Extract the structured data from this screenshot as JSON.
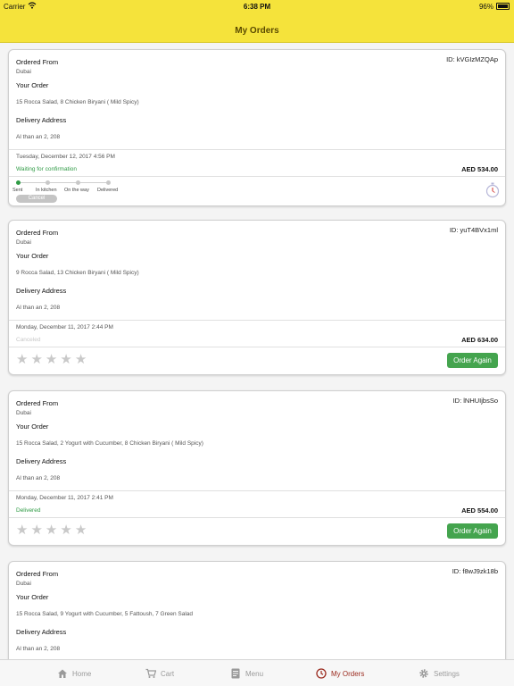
{
  "status_bar": {
    "carrier": "Carrier",
    "time": "6:38 PM",
    "battery": "96%"
  },
  "header": {
    "title": "My Orders"
  },
  "labels": {
    "ordered_from": "Ordered From",
    "your_order": "Your Order",
    "delivery_address": "Delivery Address",
    "order_again": "Order Again",
    "cancel": "Cancel"
  },
  "progress_steps": [
    "Sent",
    "In kitchen",
    "On the way",
    "Delivered"
  ],
  "colors": {
    "brand_yellow": "#f5e33b",
    "accent_green": "#44a44e",
    "active_tab": "#9b2b1f"
  },
  "orders": [
    {
      "id": "ID: kVGIzMZQAp",
      "restaurant_city": "Dubai",
      "items": "15 Rocca Salad, 8 Chicken Biryani ( Mild Spicy)",
      "address": "Al than an 2, 208",
      "date": "Tuesday, December 12, 2017 4:56 PM",
      "status": "Waiting for confirmation",
      "total": "AED 534.00",
      "progress_step": 0
    },
    {
      "id": "ID: yuT4BVx1ml",
      "restaurant_city": "Dubai",
      "items": "9 Rocca Salad, 13 Chicken Biryani ( Mild Spicy)",
      "address": "Al than an 2, 208",
      "date": "Monday, December 11, 2017 2:44 PM",
      "status": "Canceled",
      "total": "AED 634.00",
      "rating": 0
    },
    {
      "id": "ID: lNHUIjbsSo",
      "restaurant_city": "Dubai",
      "items": "15 Rocca Salad, 2 Yogurt with Cucumber, 8 Chicken Biryani ( Mild Spicy)",
      "address": "Al than an 2, 208",
      "date": "Monday, December 11, 2017 2:41 PM",
      "status": "Delivered",
      "total": "AED 554.00",
      "rating": 0
    },
    {
      "id": "ID: f8wJ9zk18b",
      "restaurant_city": "Dubai",
      "items": "15 Rocca Salad, 9 Yogurt with Cucumber, 5 Fattoush, 7 Green Salad",
      "address": "Al than an 2, 208"
    }
  ],
  "tabs": [
    {
      "label": "Home",
      "icon": "home-icon"
    },
    {
      "label": "Cart",
      "icon": "cart-icon"
    },
    {
      "label": "Menu",
      "icon": "menu-icon"
    },
    {
      "label": "My Orders",
      "icon": "clock-icon",
      "active": true
    },
    {
      "label": "Settings",
      "icon": "gear-icon"
    }
  ]
}
